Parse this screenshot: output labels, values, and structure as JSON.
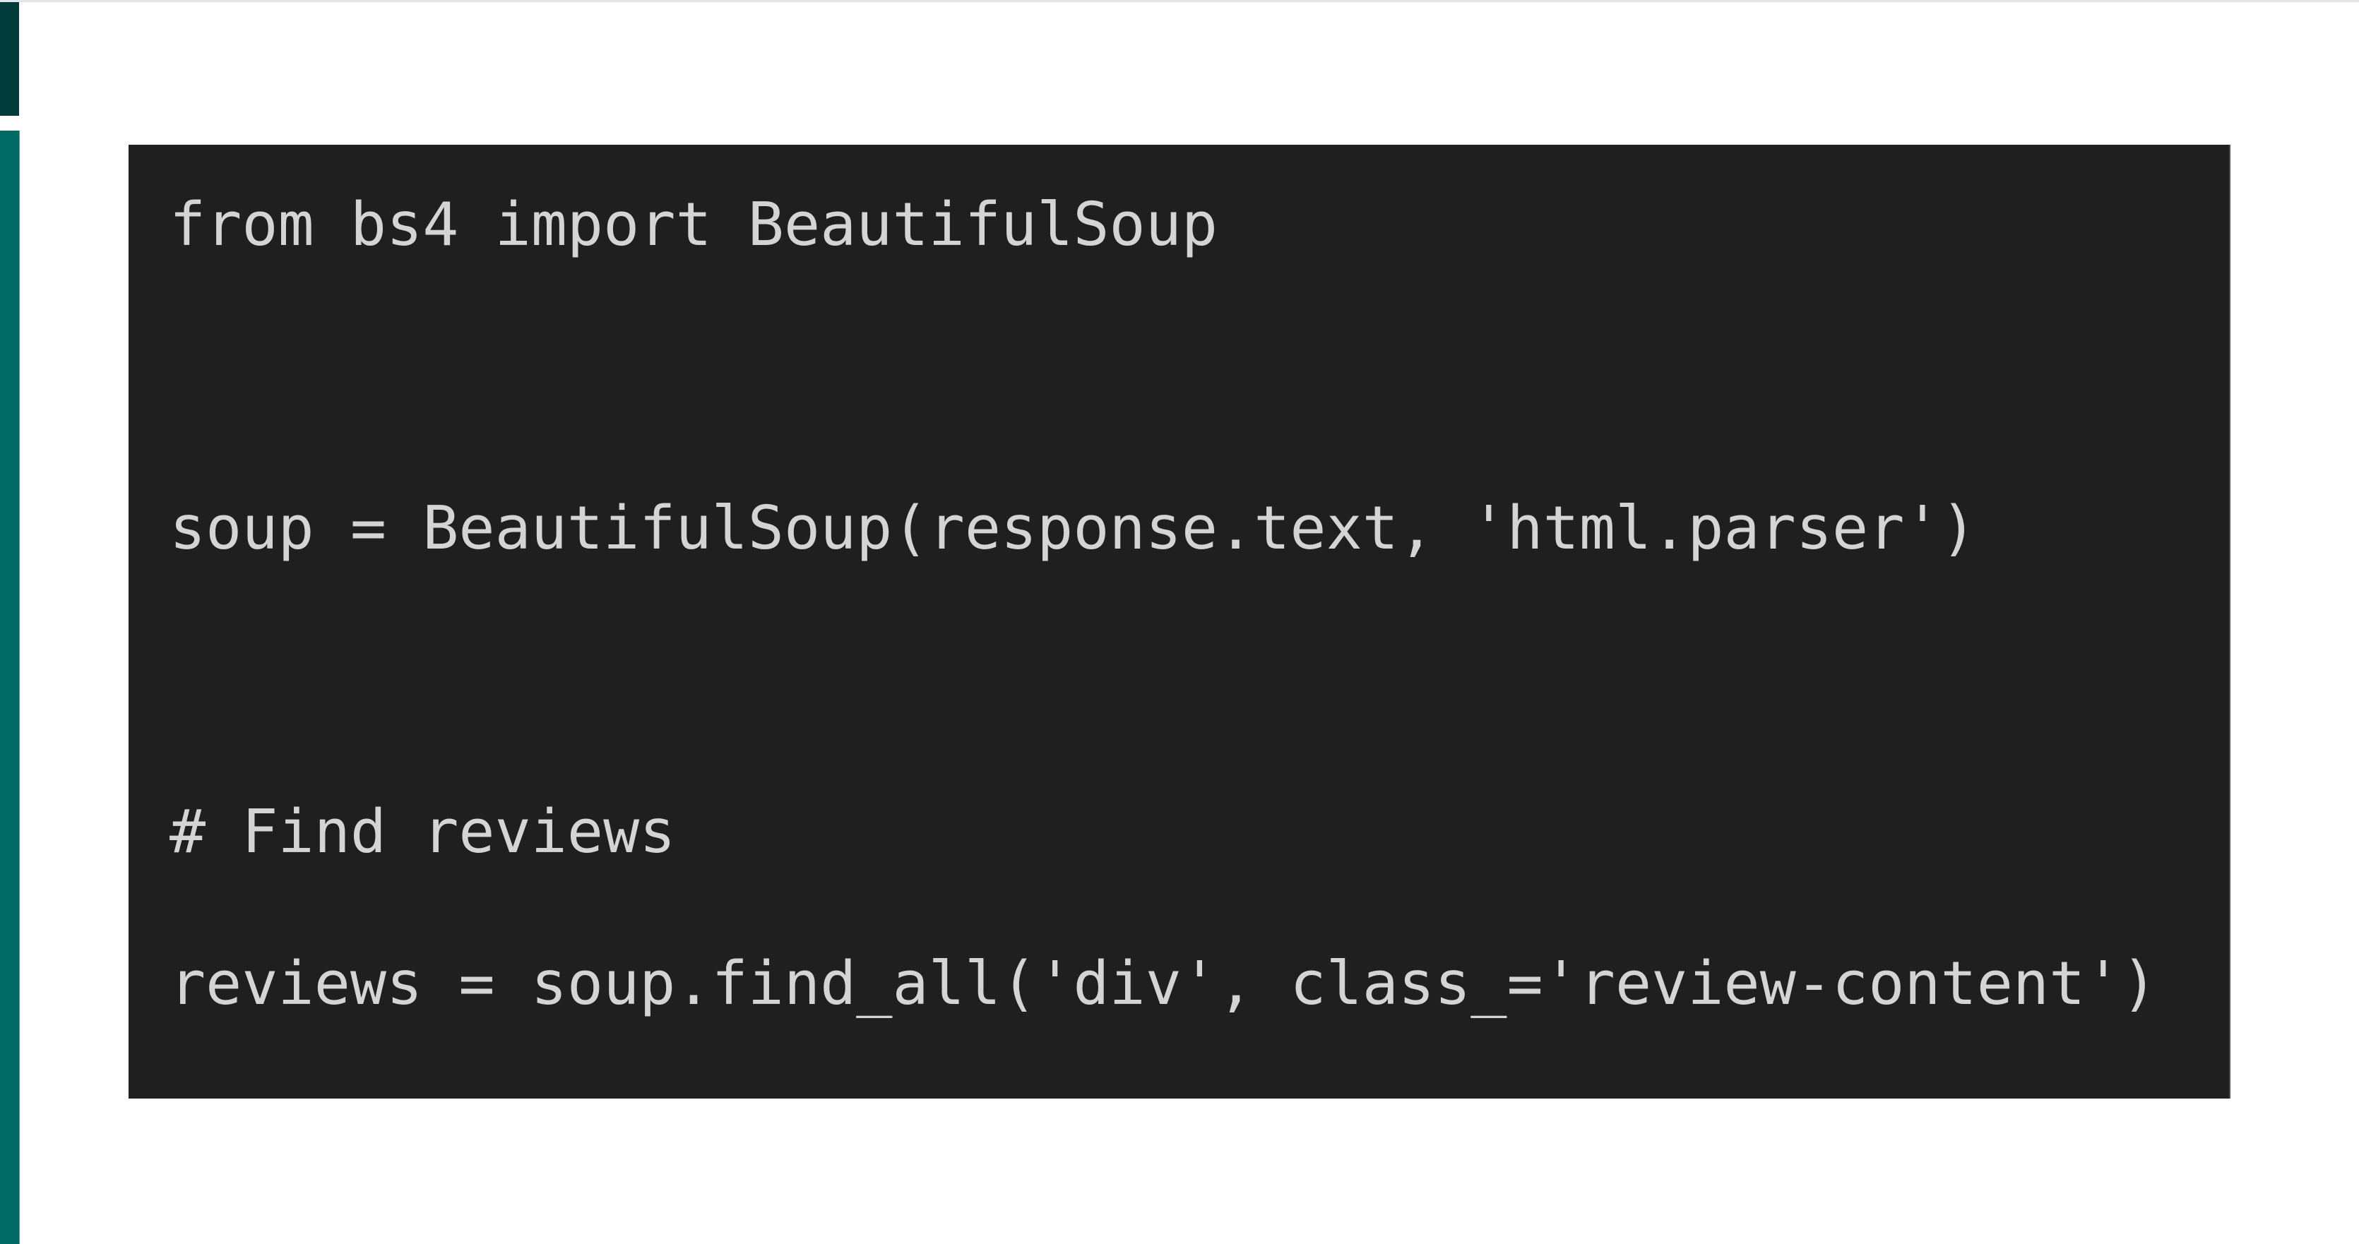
{
  "code_block": {
    "language": "python",
    "lines": [
      "from bs4 import BeautifulSoup",
      "",
      "soup = BeautifulSoup(response.text, 'html.parser')",
      "",
      "# Find reviews",
      "reviews = soup.find_all('div', class_='review-content')"
    ]
  },
  "colors": {
    "sidebar_dark": "#003d3a",
    "sidebar_teal": "#006b64",
    "code_background": "#1f1f1f",
    "code_text": "#d4d4d4"
  }
}
